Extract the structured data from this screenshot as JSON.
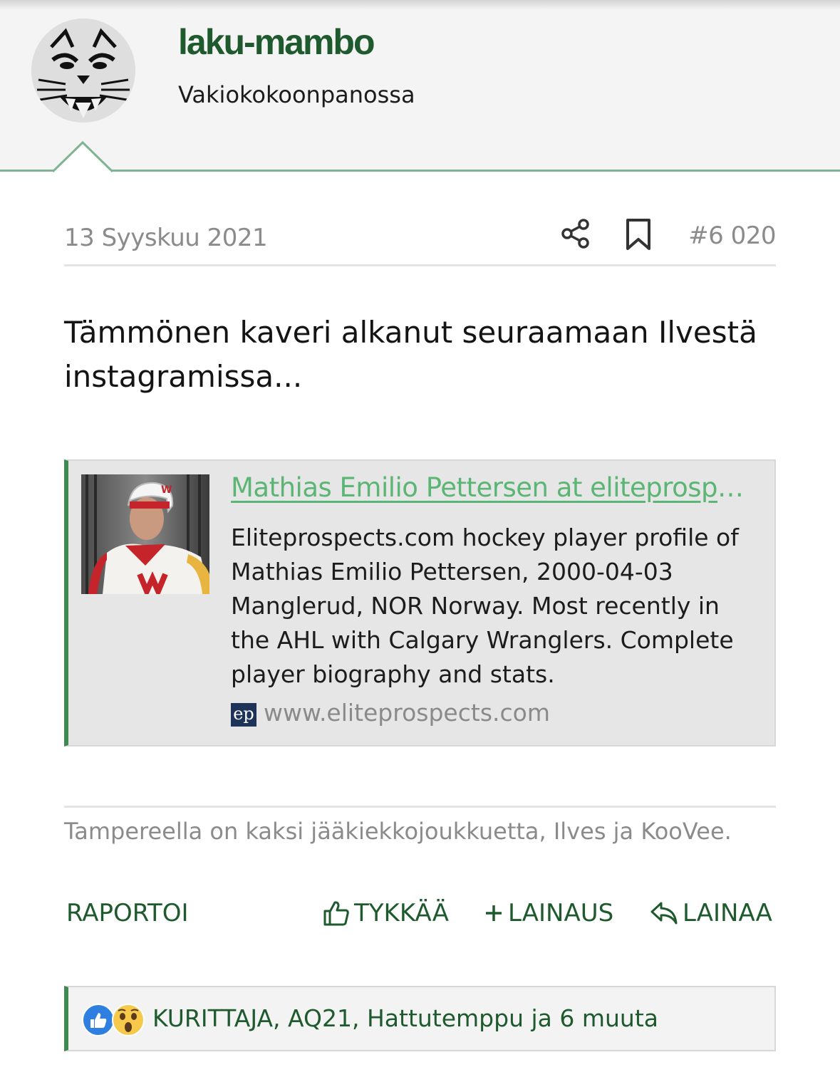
{
  "user": {
    "name": "laku-mambo",
    "title": "Vakiokokoonpanossa"
  },
  "post": {
    "date": "13 Syyskuu 2021",
    "number": "#6 020",
    "body": "Tämmönen kaveri alkanut seuraamaan Ilvestä instagramissa..."
  },
  "link_card": {
    "title": "Mathias Emilio Pettersen at eliteprospects.com",
    "description": "Eliteprospects.com hockey player profile of Mathias Emilio Pettersen, 2000-04-03 Manglerud, NOR Norway. Most recently in the AHL with Calgary Wranglers. Complete player biography and stats.",
    "favicon_text": "ep",
    "domain": "www.eliteprospects.com",
    "thumb_logo": "W"
  },
  "signature": "Tampereella on kaksi jääkiekkojoukkuetta, Ilves ja KooVee.",
  "actions": {
    "report": "RAPORTOI",
    "like": "TYKKÄÄ",
    "multiquote": "LAINAUS",
    "quote": "LAINAA"
  },
  "reactions": {
    "icons": [
      "like-reaction-icon",
      "wow-reaction-icon"
    ],
    "text": "KURITTAJA, AQ21, Hattutemppu ja 6 muuta"
  },
  "colors": {
    "brand_green": "#1f5a2e",
    "link_green": "#5bb574",
    "accent_bar": "#3f8a52",
    "divider": "#7fb394",
    "meta_gray": "#8b8b8b"
  }
}
